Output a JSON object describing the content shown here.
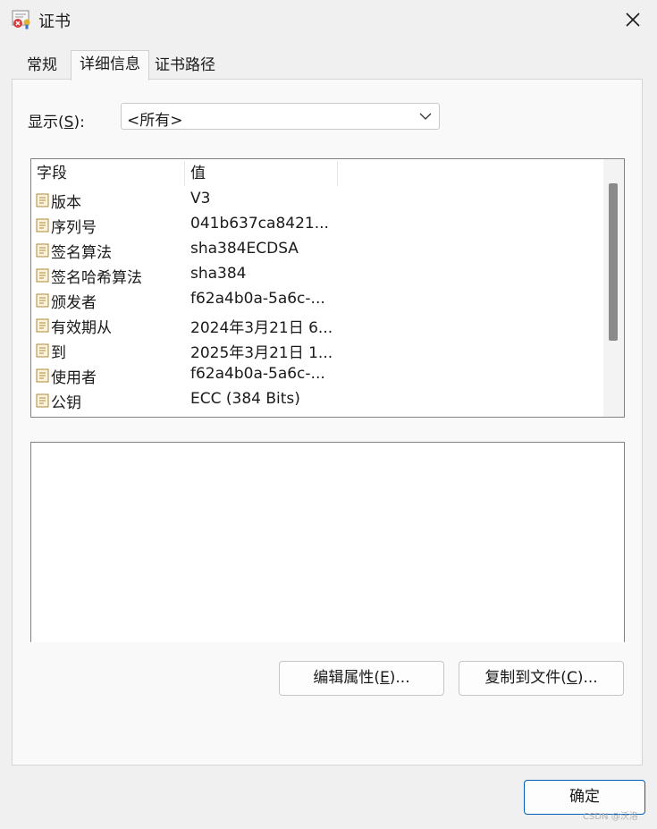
{
  "window": {
    "title": "证书",
    "close_icon": "close-icon"
  },
  "tabs": [
    {
      "label": "常规",
      "active": false
    },
    {
      "label": "详细信息",
      "active": true
    },
    {
      "label": "证书路径",
      "active": false
    }
  ],
  "show": {
    "label_prefix": "显示(",
    "label_key": "S",
    "label_suffix": "):",
    "selected": "<所有>"
  },
  "fields_table": {
    "headers": {
      "field": "字段",
      "value": "值"
    },
    "rows": [
      {
        "field": "版本",
        "value": "V3"
      },
      {
        "field": "序列号",
        "value": "041b637ca8421..."
      },
      {
        "field": "签名算法",
        "value": "sha384ECDSA"
      },
      {
        "field": "签名哈希算法",
        "value": "sha384"
      },
      {
        "field": "颁发者",
        "value": "f62a4b0a-5a6c-..."
      },
      {
        "field": "有效期从",
        "value": "2024年3月21日 6..."
      },
      {
        "field": "到",
        "value": "2025年3月21日 1..."
      },
      {
        "field": "使用者",
        "value": "f62a4b0a-5a6c-..."
      },
      {
        "field": "公钥",
        "value": "ECC (384 Bits)"
      }
    ]
  },
  "buttons": {
    "edit_properties": {
      "prefix": "编辑属性(",
      "key": "E",
      "suffix": ")..."
    },
    "copy_to_file": {
      "prefix": "复制到文件(",
      "key": "C",
      "suffix": ")..."
    },
    "ok": "确定"
  },
  "watermark": "CSDN @沃洛",
  "colors": {
    "accent": "#005fb8",
    "scroll_thumb": "#8a8a8a",
    "field_icon": "#c8a24a"
  }
}
